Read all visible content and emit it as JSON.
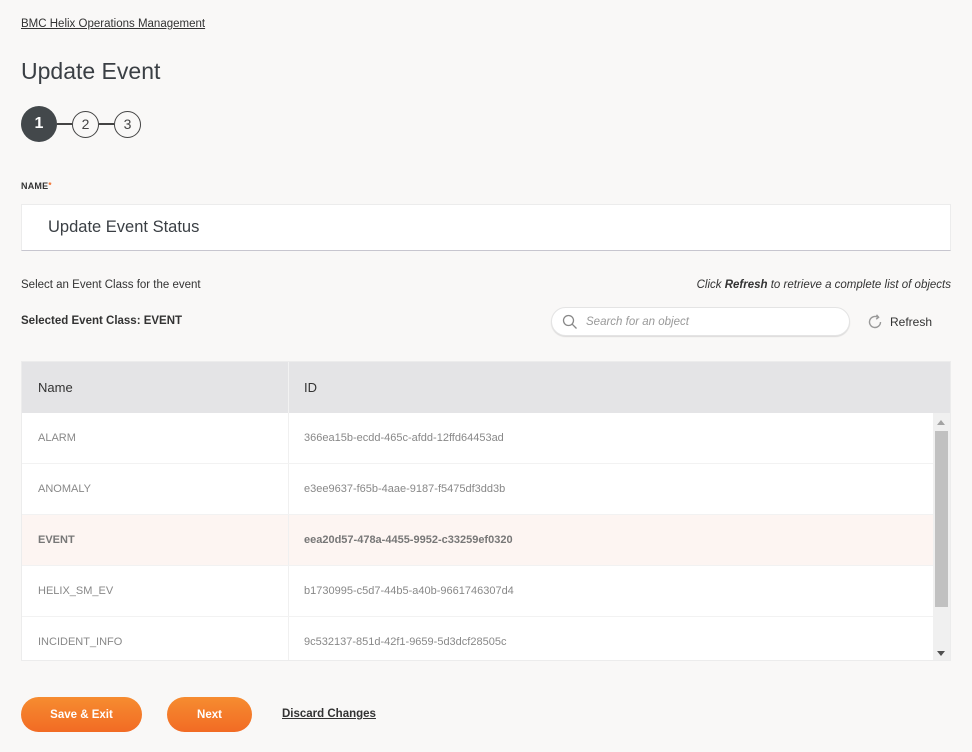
{
  "breadcrumb": "BMC Helix Operations Management",
  "page_title": "Update Event",
  "stepper": {
    "steps": [
      "1",
      "2",
      "3"
    ],
    "active_step": 1
  },
  "name_field": {
    "label": "NAME",
    "required_marker": "*",
    "value": "Update Event Status"
  },
  "instruction": "Select an Event Class for the event",
  "refresh_hint": {
    "prefix": "Click ",
    "bold": "Refresh",
    "suffix": " to retrieve a complete list of objects"
  },
  "selected_class": "Selected Event Class: EVENT",
  "search": {
    "placeholder": "Search for an object",
    "value": "",
    "icon": "search-icon"
  },
  "refresh_button": {
    "label": "Refresh",
    "icon": "refresh-icon"
  },
  "table": {
    "columns": [
      "Name",
      "ID"
    ],
    "rows": [
      {
        "name": "ALARM",
        "id": "366ea15b-ecdd-465c-afdd-12ffd64453ad",
        "selected": false
      },
      {
        "name": "ANOMALY",
        "id": "e3ee9637-f65b-4aae-9187-f5475df3dd3b",
        "selected": false
      },
      {
        "name": "EVENT",
        "id": "eea20d57-478a-4455-9952-c33259ef0320",
        "selected": true
      },
      {
        "name": "HELIX_SM_EV",
        "id": "b1730995-c5d7-44b5-a40b-9661746307d4",
        "selected": false
      },
      {
        "name": "INCIDENT_INFO",
        "id": "9c532137-851d-42f1-9659-5d3dcf28505c",
        "selected": false
      }
    ]
  },
  "footer": {
    "save_exit_label": "Save & Exit",
    "next_label": "Next",
    "discard_label": "Discard Changes"
  },
  "colors": {
    "accent": "#f26b24",
    "selected_row": "#fdf5f2",
    "active_step": "#43484b"
  }
}
